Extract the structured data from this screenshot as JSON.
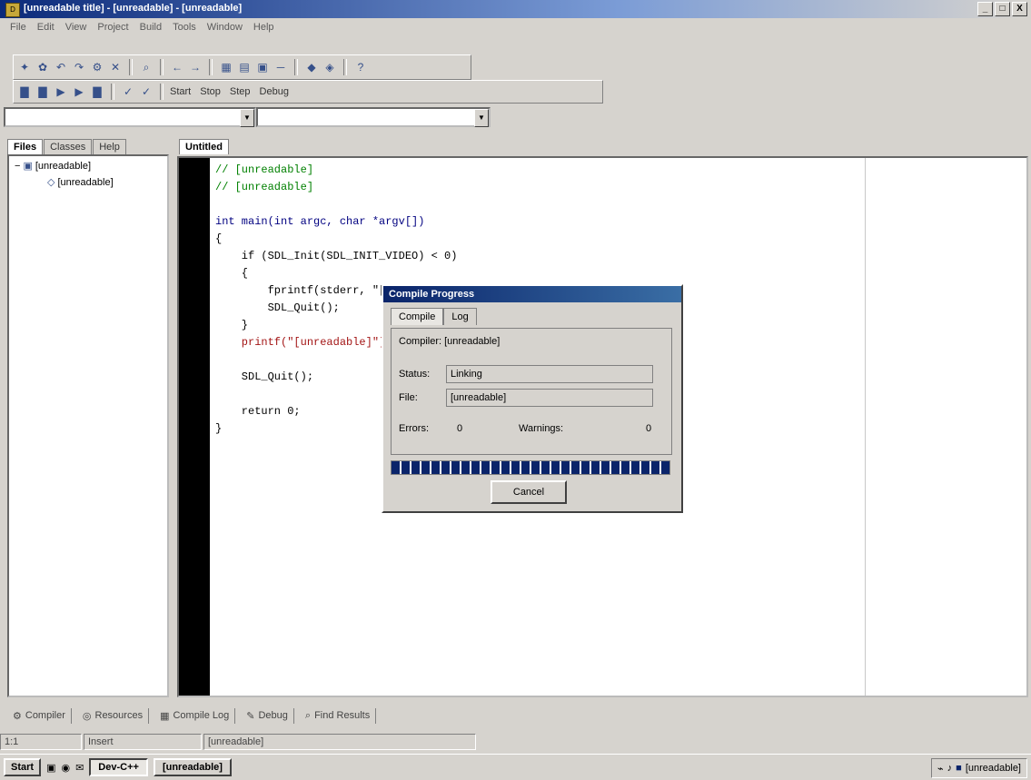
{
  "window": {
    "title": "[unreadable title] - [unreadable] - [unreadable]",
    "min_label": "_",
    "max_label": "□",
    "close_label": "X"
  },
  "menubar": [
    "File",
    "Edit",
    "View",
    "Project",
    "Build",
    "Tools",
    "Window",
    "Help"
  ],
  "toolbar2": {
    "items": [
      "Start",
      "Stop",
      "Step",
      "Debug"
    ]
  },
  "left_tabs": [
    "Files",
    "Classes",
    "Help"
  ],
  "tree": {
    "root": "[unreadable]",
    "child": "[unreadable]"
  },
  "editor_tab": "Untitled",
  "code_lines": [
    {
      "cls": "c",
      "text": "// [unreadable]"
    },
    {
      "cls": "c",
      "text": "// [unreadable]"
    },
    {
      "cls": "",
      "text": ""
    },
    {
      "cls": "k",
      "text": "int main(int argc, char *argv[])"
    },
    {
      "cls": "",
      "text": "{"
    },
    {
      "cls": "",
      "text": "    if (SDL_Init(SDL_INIT_VIDEO) < 0)"
    },
    {
      "cls": "",
      "text": "    {"
    },
    {
      "cls": "",
      "text": "        fprintf(stderr, \"[unreadable]\", SDL_GetError());"
    },
    {
      "cls": "",
      "text": "        SDL_Quit();"
    },
    {
      "cls": "",
      "text": "    }"
    },
    {
      "cls": "s",
      "text": "    printf(\"[unreadable]\");"
    },
    {
      "cls": "",
      "text": ""
    },
    {
      "cls": "",
      "text": "    SDL_Quit();"
    },
    {
      "cls": "",
      "text": ""
    },
    {
      "cls": "",
      "text": "    return 0;"
    },
    {
      "cls": "",
      "text": "}"
    }
  ],
  "dialog": {
    "title": "Compile Progress",
    "tabs": [
      "Compile",
      "Log"
    ],
    "compiler_label": "Compiler: [unreadable]",
    "status_label": "Status:",
    "status_value": "Linking",
    "file_label": "File:",
    "file_value": "[unreadable]",
    "errors_label": "Errors:",
    "errors_value": "0",
    "warnings_label": "Warnings:",
    "warnings_value": "0",
    "progress": 1.0,
    "cancel_label": "Cancel"
  },
  "bottom_tabs": [
    "Compiler",
    "Resources",
    "Compile Log",
    "Debug",
    "Find Results"
  ],
  "statusbar": [
    "1:1",
    "Insert",
    "[unreadable]"
  ],
  "taskbar": {
    "start": "Start",
    "tasks": [
      "Dev-C++",
      "[unreadable]"
    ],
    "clock": "[unreadable]"
  }
}
